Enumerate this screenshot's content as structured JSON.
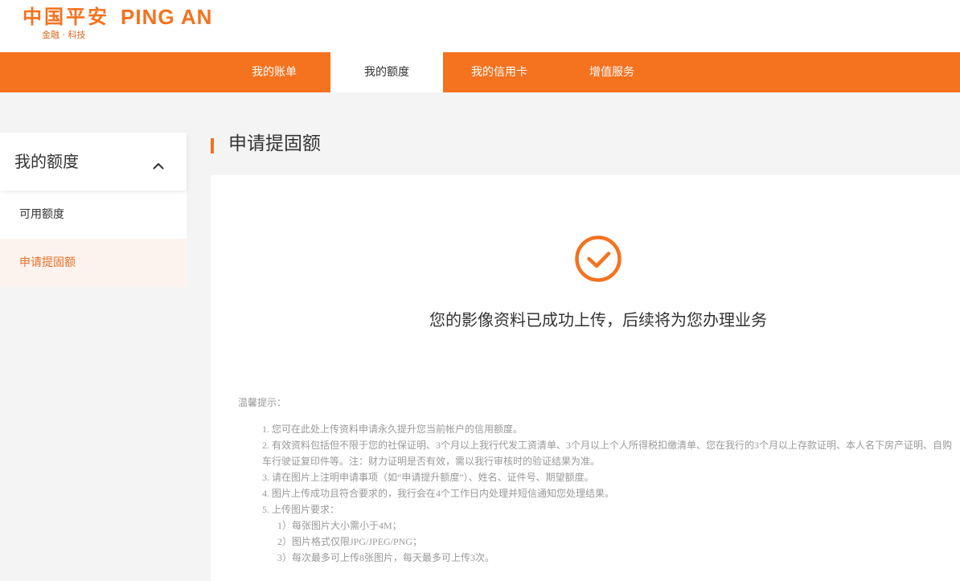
{
  "header": {
    "logo_cn": "中国平安",
    "logo_en": "PING AN",
    "slogan": "金融 · 科技"
  },
  "nav": {
    "items": [
      {
        "label": "我的账单",
        "active": false
      },
      {
        "label": "我的额度",
        "active": true
      },
      {
        "label": "我的信用卡",
        "active": false
      },
      {
        "label": "增值服务",
        "active": false
      }
    ]
  },
  "sidebar": {
    "title": "我的额度",
    "expanded": true,
    "toggle_icon": "chevron-up-icon",
    "items": [
      {
        "label": "可用额度",
        "active": false
      },
      {
        "label": "申请提固额",
        "active": true
      }
    ]
  },
  "main": {
    "title": "申请提固额",
    "status_icon": "check-circle-icon",
    "success_message": "您的影像资料已成功上传，后续将为您办理业务",
    "tips": {
      "heading": "温馨提示：",
      "items": [
        "1. 您可在此处上传资料申请永久提升您当前帐户的信用额度。",
        "2. 有效资料包括但不限于您的社保证明、3个月以上我行代发工资清单、3个月以上个人所得税扣缴清单、您在我行的3个月以上存款证明、本人名下房产证明、自购车行驶证复印件等。注：财力证明是否有效，需以我行审核时的验证结果为准。",
        "3. 请在图片上注明申请事项（如“申请提升额度”）、姓名、证件号、期望额度。",
        "4. 图片上传成功且符合要求的，我行会在4个工作日内处理并短信通知您处理结果。",
        "5. 上传图片要求："
      ],
      "upload_requirements": [
        "1）每张图片大小需小于4M；",
        "2）图片格式仅限JPG/JPEG/PNG；",
        "3）每次最多可上传8张图片，每天最多可上传3次。"
      ]
    }
  },
  "colors": {
    "brand_orange": "#f5721f",
    "page_background": "#f4f4f4",
    "active_sidebar_background": "#fdf3ee",
    "active_sidebar_text": "#e8702a",
    "tip_text": "#999999"
  }
}
